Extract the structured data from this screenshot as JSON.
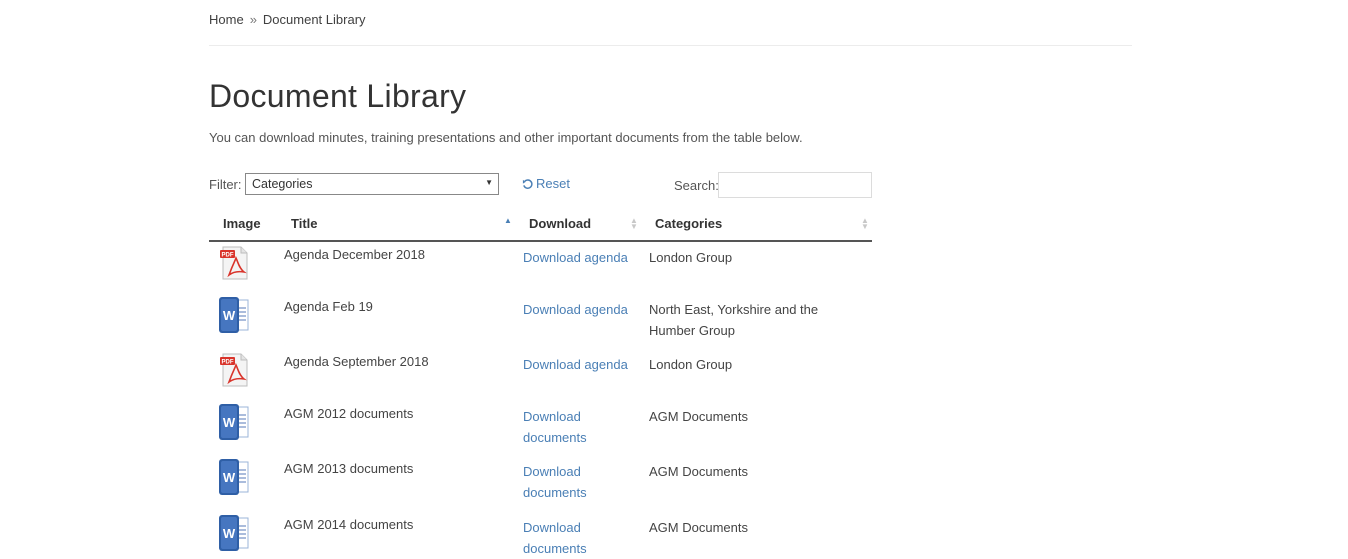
{
  "breadcrumb": {
    "home": "Home",
    "separator": "»",
    "current": "Document Library"
  },
  "page": {
    "title": "Document Library",
    "intro": "You can download minutes, training presentations and other important documents from the table below."
  },
  "filter": {
    "label": "Filter:",
    "selected": "Categories",
    "reset_label": "Reset"
  },
  "search": {
    "label": "Search:",
    "value": ""
  },
  "table": {
    "headers": {
      "image": "Image",
      "title": "Title",
      "download": "Download",
      "categories": "Categories"
    },
    "sort": {
      "column": "title",
      "direction": "ascending"
    },
    "rows": [
      {
        "icon": "pdf-icon",
        "title": "Agenda December 2018",
        "download": "Download agenda",
        "category": "London Group"
      },
      {
        "icon": "word-doc-icon",
        "title": "Agenda Feb 19",
        "download": "Download agenda",
        "category": "North East, Yorkshire and the Humber Group"
      },
      {
        "icon": "pdf-icon",
        "title": "Agenda September 2018",
        "download": "Download agenda",
        "category": "London Group"
      },
      {
        "icon": "word-doc-icon",
        "title": "AGM 2012 documents",
        "download": "Download documents",
        "category": "AGM Documents"
      },
      {
        "icon": "word-doc-icon",
        "title": "AGM 2013 documents",
        "download": "Download documents",
        "category": "AGM Documents"
      },
      {
        "icon": "word-doc-icon",
        "title": "AGM 2014 documents",
        "download": "Download documents",
        "category": "AGM Documents"
      }
    ]
  },
  "colors": {
    "link": "#4a7fb5",
    "text": "#404040",
    "header_rule": "#555555"
  }
}
